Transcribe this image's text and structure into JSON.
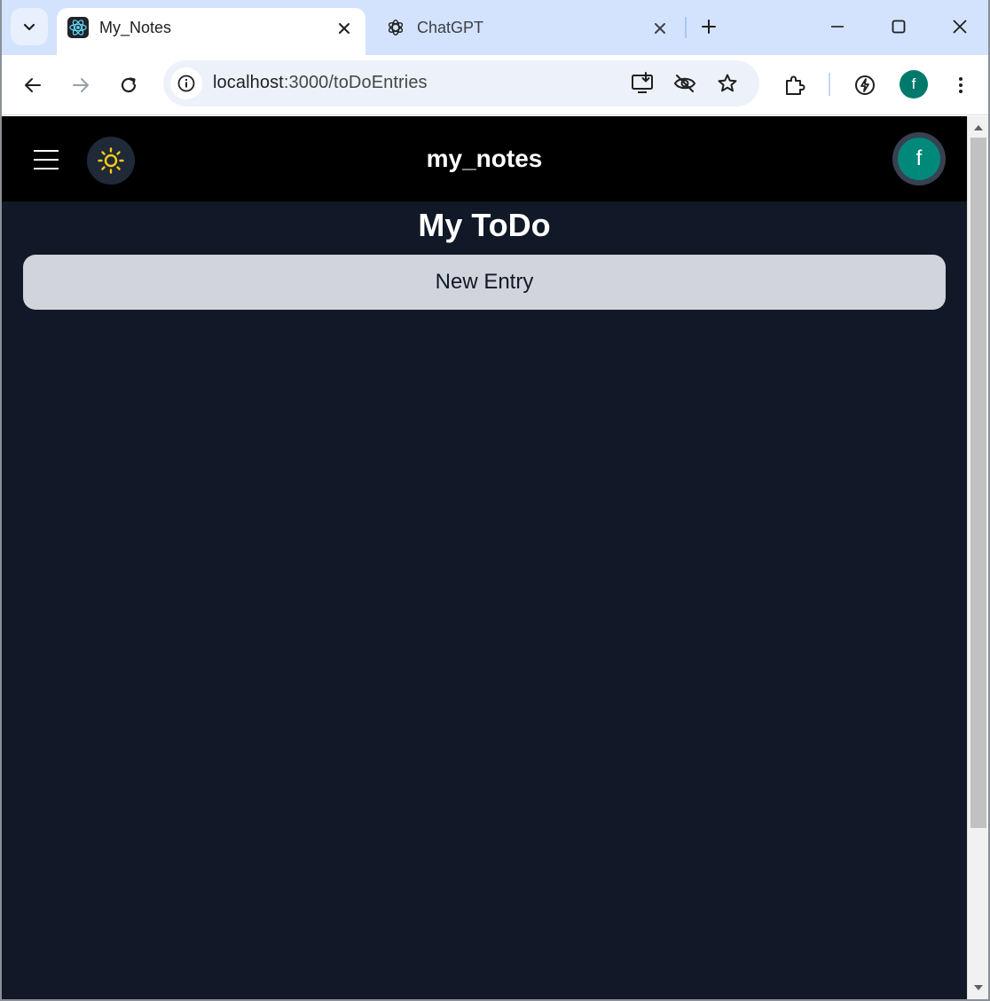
{
  "browser": {
    "tabs": [
      {
        "title": "My_Notes",
        "active": true,
        "favicon": "react-icon"
      },
      {
        "title": "ChatGPT",
        "active": false,
        "favicon": "openai-icon"
      }
    ],
    "address_bar": {
      "host": "localhost",
      "path": ":3000/toDoEntries"
    },
    "profile_initial": "f",
    "profile_color": "#00796b"
  },
  "app": {
    "title": "my_notes",
    "user_initial": "f",
    "theme_icon": "sun-icon",
    "accent_sun": "#facc15",
    "background": "#111827",
    "header_background": "#000000"
  },
  "page": {
    "heading": "My ToDo",
    "new_entry_label": "New Entry"
  }
}
